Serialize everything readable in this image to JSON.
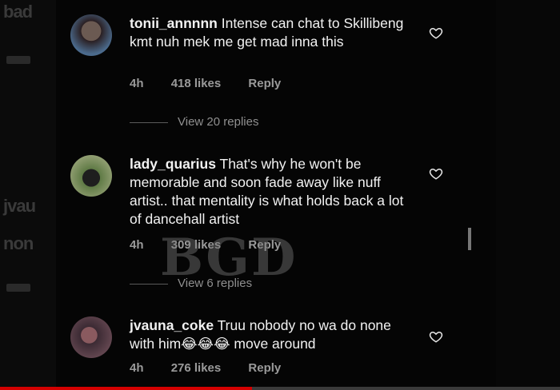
{
  "background_ghost_text": [
    "bad",
    "jvau",
    "non"
  ],
  "watermark": "BGD",
  "comments": [
    {
      "username": "tonii_annnnn",
      "text": " Intense can chat to Skillibeng kmt nuh mek me get mad inna this",
      "time": "4h",
      "likes": "418 likes",
      "reply": "Reply",
      "view_replies": "View 20 replies"
    },
    {
      "username": "lady_quarius",
      "text": " That's why he won't be memorable and soon fade away like nuff artist.. that mentality is what holds back a lot of dancehall artist",
      "time": "4h",
      "likes": "309 likes",
      "reply": "Reply",
      "view_replies": "View 6 replies"
    },
    {
      "username": "jvauna_coke",
      "text": " Truu nobody no wa do none with him😂😂😂 move around",
      "time": "4h",
      "likes": "276 likes",
      "reply": "Reply"
    }
  ],
  "video_progress": 0.45,
  "colors": {
    "progress": "#d40000",
    "meta": "#9a9a9a"
  }
}
